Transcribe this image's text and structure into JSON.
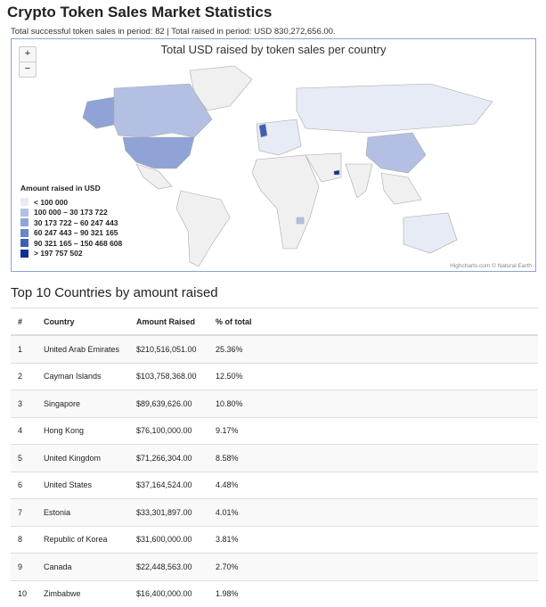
{
  "header": {
    "title": "Crypto Token Sales Market Statistics",
    "summary": "Total successful token sales in period: 82 | Total raised in period: USD 830,272,656.00."
  },
  "map": {
    "title": "Total USD raised by token sales per country",
    "zoom_in": "+",
    "zoom_out": "−",
    "credit": "Highcharts.com © Natural Earth",
    "legend": {
      "title": "Amount raised in USD",
      "items": [
        {
          "label": "< 100 000",
          "color": "#e6ebf5"
        },
        {
          "label": "100 000 – 30 173 722",
          "color": "#b3c0e3"
        },
        {
          "label": "30 173 722 – 60 247 443",
          "color": "#8fa3d6"
        },
        {
          "label": "60 247 443 – 90 321 165",
          "color": "#6b85c9"
        },
        {
          "label": "90 321 165 – 150 468 608",
          "color": "#3d5fb8"
        },
        {
          "label": "> 197 757 502",
          "color": "#0a2f99"
        }
      ]
    }
  },
  "table": {
    "title": "Top 10 Countries by amount raised",
    "headers": [
      "#",
      "Country",
      "Amount Raised",
      "% of total"
    ],
    "rows": [
      [
        "1",
        "United Arab Emirates",
        "$210,516,051.00",
        "25.36%"
      ],
      [
        "2",
        "Cayman Islands",
        "$103,758,368.00",
        "12.50%"
      ],
      [
        "3",
        "Singapore",
        "$89,639,626.00",
        "10.80%"
      ],
      [
        "4",
        "Hong Kong",
        "$76,100,000.00",
        "9.17%"
      ],
      [
        "5",
        "United Kingdom",
        "$71,266,304.00",
        "8.58%"
      ],
      [
        "6",
        "United States",
        "$37,164,524.00",
        "4.48%"
      ],
      [
        "7",
        "Estonia",
        "$33,301,897.00",
        "4.01%"
      ],
      [
        "8",
        "Republic of Korea",
        "$31,600,000.00",
        "3.81%"
      ],
      [
        "9",
        "Canada",
        "$22,448,563.00",
        "2.70%"
      ],
      [
        "10",
        "Zimbabwe",
        "$16,400,000.00",
        "1.98%"
      ]
    ]
  }
}
